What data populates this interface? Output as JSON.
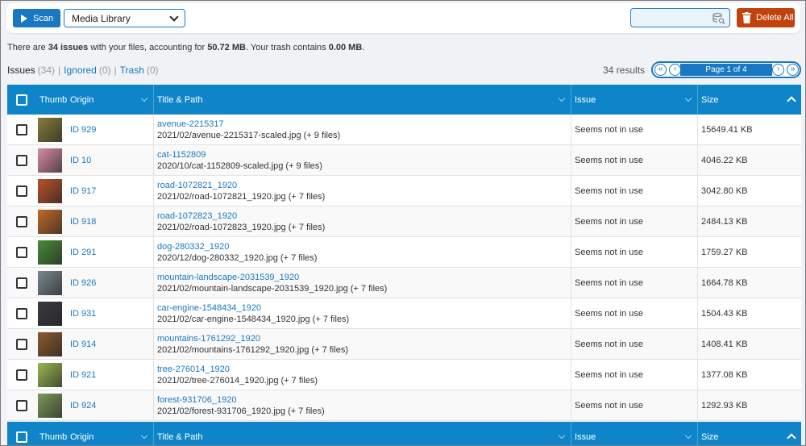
{
  "toolbar": {
    "scan_label": "Scan",
    "source_select": "Media Library",
    "search_placeholder": "",
    "delete_all_label": "Delete All"
  },
  "summary": {
    "prefix": "There are ",
    "issues": "34 issues",
    "mid": " with your files, accounting for ",
    "size": "50.72 MB",
    "mid2": ". Your trash contains ",
    "trash": "0.00 MB",
    "suffix": "."
  },
  "tabs": {
    "issues_label": "Issues",
    "issues_count": "(34)",
    "ignored_label": "Ignored",
    "ignored_count": "(0)",
    "trash_label": "Trash",
    "trash_count": "(0)",
    "sep": "|"
  },
  "results": "34 results",
  "pager": {
    "first": "«",
    "prev": "‹",
    "label": "Page 1 of 4",
    "next": "›",
    "last": "»"
  },
  "columns": {
    "thumb": "Thumb",
    "origin": "Origin",
    "title": "Title & Path",
    "issue": "Issue",
    "size": "Size"
  },
  "rows": [
    {
      "origin": "ID 929",
      "title": "avenue-2215317",
      "path": "2021/02/avenue-2215317-scaled.jpg (+ 9 files)",
      "issue": "Seems not in use",
      "size": "15649.41 KB",
      "thumb_color": "#8a7a3a"
    },
    {
      "origin": "ID 10",
      "title": "cat-1152809",
      "path": "2020/10/cat-1152809-scaled.jpg (+ 9 files)",
      "issue": "Seems not in use",
      "size": "4046.22 KB",
      "thumb_color": "#d98aa8"
    },
    {
      "origin": "ID 917",
      "title": "road-1072821_1920",
      "path": "2021/02/road-1072821_1920.jpg (+ 7 files)",
      "issue": "Seems not in use",
      "size": "3042.80 KB",
      "thumb_color": "#b8502a"
    },
    {
      "origin": "ID 918",
      "title": "road-1072823_1920",
      "path": "2021/02/road-1072823_1920.jpg (+ 7 files)",
      "issue": "Seems not in use",
      "size": "2484.13 KB",
      "thumb_color": "#c06a28"
    },
    {
      "origin": "ID 291",
      "title": "dog-280332_1920",
      "path": "2020/12/dog-280332_1920.jpg (+ 7 files)",
      "issue": "Seems not in use",
      "size": "1759.27 KB",
      "thumb_color": "#4a8a3a"
    },
    {
      "origin": "ID 926",
      "title": "mountain-landscape-2031539_1920",
      "path": "2021/02/mountain-landscape-2031539_1920.jpg (+ 7 files)",
      "issue": "Seems not in use",
      "size": "1664.78 KB",
      "thumb_color": "#7a8890"
    },
    {
      "origin": "ID 931",
      "title": "car-engine-1548434_1920",
      "path": "2021/02/car-engine-1548434_1920.jpg (+ 7 files)",
      "issue": "Seems not in use",
      "size": "1504.43 KB",
      "thumb_color": "#3a3a40"
    },
    {
      "origin": "ID 914",
      "title": "mountains-1761292_1920",
      "path": "2021/02/mountains-1761292_1920.jpg (+ 7 files)",
      "issue": "Seems not in use",
      "size": "1408.41 KB",
      "thumb_color": "#8a5a30"
    },
    {
      "origin": "ID 921",
      "title": "tree-276014_1920",
      "path": "2021/02/tree-276014_1920.jpg (+ 7 files)",
      "issue": "Seems not in use",
      "size": "1377.08 KB",
      "thumb_color": "#9ab850"
    },
    {
      "origin": "ID 924",
      "title": "forest-931706_1920",
      "path": "2021/02/forest-931706_1920.jpg (+ 7 files)",
      "issue": "Seems not in use",
      "size": "1292.93 KB",
      "thumb_color": "#7a9a5a"
    }
  ]
}
